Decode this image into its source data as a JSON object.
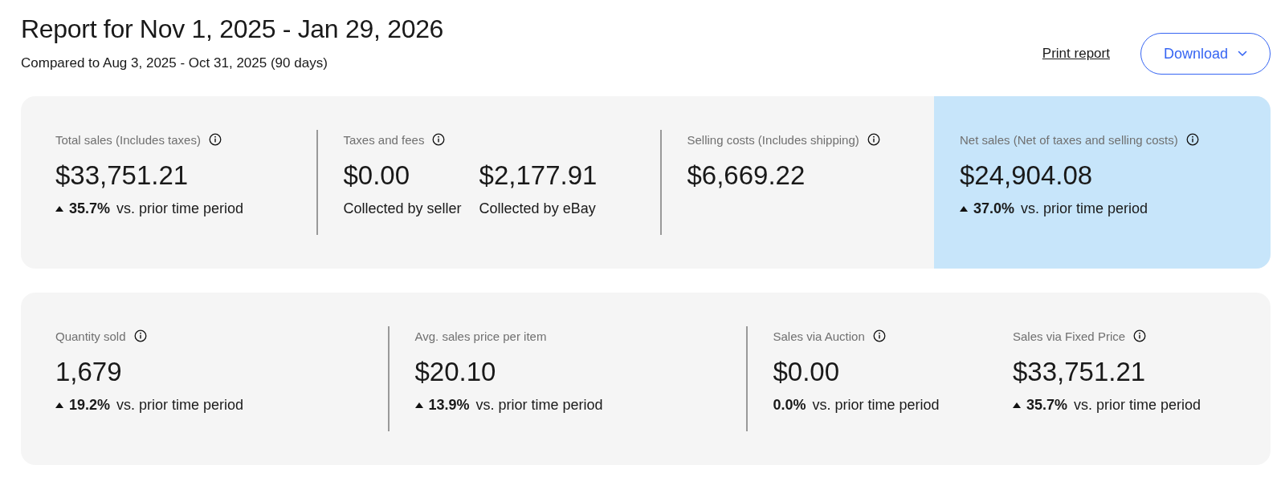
{
  "header": {
    "title": "Report for Nov 1, 2025 - Jan 29, 2026",
    "subtitle": "Compared to Aug 3, 2025 - Oct 31, 2025 (90 days)",
    "print_link": "Print report",
    "download_button": "Download"
  },
  "cards": [
    {
      "sections": [
        {
          "label": "Total sales (Includes taxes)",
          "info": true,
          "divider_before": false,
          "highlight": false,
          "amounts": [
            {
              "value": "$33,751.21"
            }
          ],
          "change": {
            "up": true,
            "percent": "35.7%",
            "text": "vs. prior time period"
          }
        },
        {
          "label": "Taxes and fees",
          "info": true,
          "divider_before": true,
          "highlight": false,
          "amounts": [
            {
              "value": "$0.00",
              "caption": "Collected by seller"
            },
            {
              "value": "$2,177.91",
              "caption": "Collected by eBay"
            }
          ]
        },
        {
          "label": "Selling costs (Includes shipping)",
          "info": true,
          "divider_before": true,
          "highlight": false,
          "amounts": [
            {
              "value": "$6,669.22"
            }
          ]
        },
        {
          "label": "Net sales (Net of taxes and selling costs)",
          "info": true,
          "divider_before": false,
          "highlight": true,
          "amounts": [
            {
              "value": "$24,904.08"
            }
          ],
          "change": {
            "up": true,
            "percent": "37.0%",
            "text": "vs. prior time period"
          }
        }
      ]
    },
    {
      "sections": [
        {
          "label": "Quantity sold",
          "info": true,
          "divider_before": false,
          "highlight": false,
          "amounts": [
            {
              "value": "1,679"
            }
          ],
          "change": {
            "up": true,
            "percent": "19.2%",
            "text": "vs. prior time period"
          }
        },
        {
          "label": "Avg. sales price per item",
          "info": false,
          "divider_before": true,
          "highlight": false,
          "amounts": [
            {
              "value": "$20.10"
            }
          ],
          "change": {
            "up": true,
            "percent": "13.9%",
            "text": "vs. prior time period"
          }
        },
        {
          "label": "Sales via Auction",
          "info": true,
          "divider_before": true,
          "highlight": false,
          "amounts": [
            {
              "value": "$0.00"
            }
          ],
          "change": {
            "up": false,
            "percent": "0.0%",
            "text": "vs. prior time period"
          }
        },
        {
          "label": "Sales via Fixed Price",
          "info": true,
          "divider_before": false,
          "highlight": false,
          "amounts": [
            {
              "value": "$33,751.21"
            }
          ],
          "change": {
            "up": true,
            "percent": "35.7%",
            "text": "vs. prior time period"
          }
        }
      ]
    }
  ]
}
